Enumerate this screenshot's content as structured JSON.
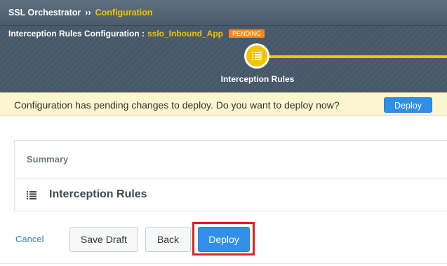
{
  "breadcrumb": {
    "root": "SSL Orchestrator",
    "separator": "››",
    "current": "Configuration"
  },
  "header": {
    "config_label": "Interception Rules Configuration :",
    "app_name": "sslo_Inbound_App",
    "status_badge": "PENDING",
    "step": {
      "label": "Interception Rules",
      "icon": "list-icon"
    }
  },
  "notice": {
    "text": "Configuration has pending changes to deploy. Do you want to deploy now?",
    "deploy_label": "Deploy"
  },
  "summary": {
    "title": "Summary",
    "rows": [
      {
        "icon": "list-icon",
        "label": "Interception Rules"
      }
    ]
  },
  "actions": {
    "cancel_label": "Cancel",
    "save_draft_label": "Save Draft",
    "back_label": "Back",
    "deploy_label": "Deploy"
  },
  "colors": {
    "accent_yellow": "#f4c400",
    "header_bg": "#46586a",
    "pending_badge": "#f08a1e",
    "notice_bg": "#fbf6cf",
    "primary_blue": "#3390ea",
    "highlight_red": "#e3211c"
  }
}
